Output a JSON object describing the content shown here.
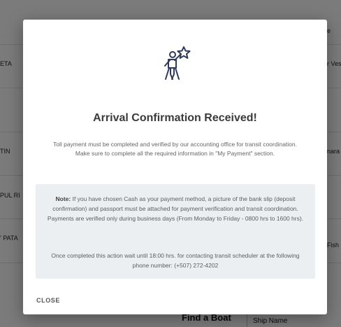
{
  "background": {
    "left_labels": [
      "ETA",
      "TIN",
      "PUL RI",
      "' PATA"
    ],
    "right_labels": [
      "e",
      "r Ves",
      "nara",
      "Fish"
    ],
    "footer": {
      "find_boat": "Find a Boat",
      "ship_name": "Ship Name"
    }
  },
  "modal": {
    "icon": "person-holding-star-icon",
    "title": "Arrival Confirmation Received!",
    "body": "Toll payment must be completed and verified by our accounting office for transit coordination. Make sure to complete all the required information in \"My Payment\" section.",
    "note": {
      "label": "Note:",
      "text": " If you have chosen Cash as your payment method, a picture of the bank slip (deposit confirmation) and passport must be attached for payment verification and transit coordination. Payments are verified only during business days (From Monday to Friday - 0800 hrs to 1600 hrs).",
      "followup": "Once completed this action wait until 18:00 hrs. for contacting transit scheduler at the following phone number: (+507) 272-4202"
    },
    "close_label": "CLOSE"
  },
  "colors": {
    "overlay": "#000000",
    "note_background": "#eceff2",
    "icon_stroke": "#2e3a59"
  }
}
